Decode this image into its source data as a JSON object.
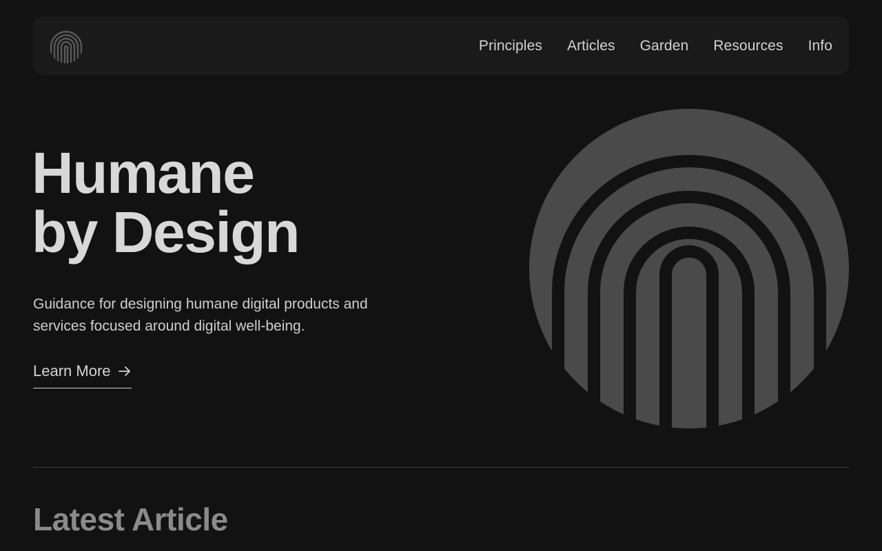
{
  "nav": {
    "logo_icon": "fingerprint-icon",
    "links": [
      {
        "label": "Principles"
      },
      {
        "label": "Articles"
      },
      {
        "label": "Garden"
      },
      {
        "label": "Resources"
      },
      {
        "label": "Info"
      }
    ]
  },
  "hero": {
    "title_line1": "Humane",
    "title_line2": "by Design",
    "description": "Guidance for designing humane digital products and services focused around digital well-being.",
    "cta_label": "Learn More",
    "cta_icon": "arrow-right-icon",
    "graphic_icon": "fingerprint-arches-icon"
  },
  "latest": {
    "title": "Latest Article"
  },
  "colors": {
    "background": "#121212",
    "nav_background": "#1a1a1a",
    "graphic": "#4a4a4a",
    "text": "#d6d6d6",
    "muted_heading": "#8a8a8a"
  }
}
